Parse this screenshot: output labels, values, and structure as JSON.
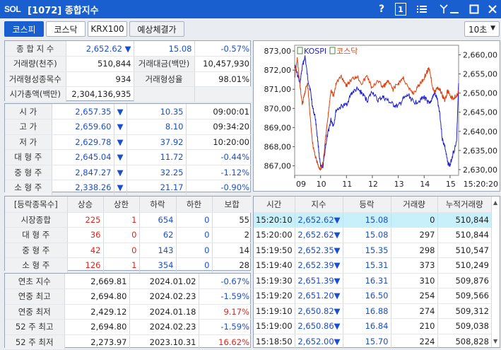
{
  "window": {
    "logo": "SOL",
    "title": "[1072] 종합지수"
  },
  "tabs": [
    "코스피",
    "코스닥",
    "KRX100",
    "예상체결가"
  ],
  "interval": "10초",
  "summary": {
    "index_label": "종 합 지 수",
    "index": "2,652.62",
    "change": "15.08",
    "change_pct": "-0.57%",
    "volume_label": "거래량(천주)",
    "volume": "510,844",
    "amount_label": "거래대금(백만)",
    "amount": "10,457,930",
    "formed_count_label": "거래형성종목수",
    "formed_count": "934",
    "formed_rate_label": "거래형성율",
    "formed_rate": "98.01%",
    "market_cap_label": "시가총액(백만)",
    "market_cap": "2,304,136,935"
  },
  "ohlc": [
    {
      "label": "시   가",
      "value": "2,657.35",
      "change": "10.35",
      "extra": "09:00:01",
      "extra_color": "black"
    },
    {
      "label": "고   가",
      "value": "2,659.60",
      "change": "8.10",
      "extra": "09:34:20",
      "extra_color": "black"
    },
    {
      "label": "저   가",
      "value": "2,629.78",
      "change": "37.92",
      "extra": "10:20:00",
      "extra_color": "black"
    },
    {
      "label": "대 형 주",
      "value": "2,645.04",
      "change": "11.72",
      "extra": "-0.44%",
      "extra_color": "blue"
    },
    {
      "label": "중 형 주",
      "value": "2,847.27",
      "change": "32.25",
      "extra": "-1.12%",
      "extra_color": "blue"
    },
    {
      "label": "소 형 주",
      "value": "2,338.26",
      "change": "21.17",
      "extra": "-0.90%",
      "extra_color": "blue"
    }
  ],
  "breadth": {
    "headers": [
      "[등락종목수]",
      "상승",
      "상한",
      "하락",
      "하한",
      "보합"
    ],
    "rows": [
      {
        "label": "시장종합",
        "up": "225",
        "upper": "1",
        "down": "654",
        "lower": "0",
        "flat": "55"
      },
      {
        "label": "대 형 주",
        "up": "36",
        "upper": "0",
        "down": "62",
        "lower": "0",
        "flat": "2"
      },
      {
        "label": "중 형 주",
        "up": "42",
        "upper": "0",
        "down": "143",
        "lower": "0",
        "flat": "14"
      },
      {
        "label": "소 형 주",
        "up": "126",
        "upper": "1",
        "down": "354",
        "lower": "0",
        "flat": "28"
      }
    ]
  },
  "yearly": [
    {
      "label": "연초  지수",
      "value": "2,669.81",
      "date": "2024.01.02",
      "pct": "-0.67%",
      "color": "blue"
    },
    {
      "label": "연중  최고",
      "value": "2,694.80",
      "date": "2024.02.23",
      "pct": "-1.59%",
      "color": "blue"
    },
    {
      "label": "연중  최저",
      "value": "2,429.12",
      "date": "2024.01.18",
      "pct": "9.17%",
      "color": "red"
    },
    {
      "label": "52 주 최고",
      "value": "2,694.80",
      "date": "2024.02.23",
      "pct": "-1.59%",
      "color": "blue"
    },
    {
      "label": "52 주 최저",
      "value": "2,273.97",
      "date": "2023.10.31",
      "pct": "16.62%",
      "color": "red"
    }
  ],
  "ticks": {
    "headers": [
      "시간",
      "지수",
      "등락",
      "거래량",
      "누적거래량"
    ],
    "rows": [
      {
        "time": "15:20:10",
        "index": "2,652.62",
        "change": "15.08",
        "vol": "0",
        "cum": "510,844"
      },
      {
        "time": "15:20:00",
        "index": "2,652.62",
        "change": "15.08",
        "vol": "297",
        "cum": "510,844"
      },
      {
        "time": "15:19:50",
        "index": "2,652.35",
        "change": "15.35",
        "vol": "298",
        "cum": "510,547"
      },
      {
        "time": "15:19:40",
        "index": "2,652.39",
        "change": "15.31",
        "vol": "373",
        "cum": "510,249"
      },
      {
        "time": "15:19:30",
        "index": "2,651.39",
        "change": "16.31",
        "vol": "310",
        "cum": "509,876"
      },
      {
        "time": "15:19:20",
        "index": "2,651.20",
        "change": "16.50",
        "vol": "254",
        "cum": "509,566"
      },
      {
        "time": "15:19:10",
        "index": "2,650.82",
        "change": "16.88",
        "vol": "274",
        "cum": "509,312"
      },
      {
        "time": "15:19:00",
        "index": "2,650.86",
        "change": "16.84",
        "vol": "210",
        "cum": "509,038"
      },
      {
        "time": "15:18:50",
        "index": "2,652.00",
        "change": "15.70",
        "vol": "224",
        "cum": "508,828"
      }
    ]
  },
  "chart_data": {
    "type": "line",
    "legend": [
      "KOSPI",
      "코스닥"
    ],
    "left_axis_ticks": [
      "873,00",
      "872,00",
      "871,00",
      "870,00",
      "869,00",
      "868,00",
      "867,00"
    ],
    "right_axis_ticks": [
      "2,660,00",
      "2,655,00",
      "2,650,00",
      "2,645,00",
      "2,640,00",
      "2,635,00",
      "2,630,00"
    ],
    "x_ticks": [
      "09",
      "10",
      "11",
      "12",
      "13",
      "14",
      "15",
      "15:20:20"
    ],
    "ylim_left": [
      866.5,
      873.3
    ],
    "ylim_right": [
      2628.5,
      2662.5
    ],
    "series": [
      {
        "name": "KOSPI",
        "axis": "right",
        "color": "#1f1fd0",
        "x": [
          9.0,
          9.1,
          9.2,
          9.3,
          9.4,
          9.5,
          9.6,
          9.7,
          9.8,
          9.9,
          10.0,
          10.1,
          10.2,
          10.3,
          10.4,
          10.5,
          10.6,
          10.8,
          11.0,
          11.2,
          11.4,
          11.6,
          11.8,
          12.0,
          12.2,
          12.4,
          12.6,
          12.8,
          13.0,
          13.2,
          13.4,
          13.6,
          13.8,
          14.0,
          14.1,
          14.2,
          14.3,
          14.4,
          14.5,
          14.6,
          14.7,
          14.8,
          14.9,
          15.0,
          15.1,
          15.25,
          15.33
        ],
        "y": [
          2657.3,
          2655.0,
          2652.5,
          2657.0,
          2659.6,
          2654.0,
          2651.0,
          2646.0,
          2643.5,
          2637.0,
          2630.5,
          2631.0,
          2636.5,
          2640.0,
          2643.0,
          2641.5,
          2645.5,
          2646.5,
          2647.0,
          2650.0,
          2651.0,
          2650.0,
          2648.0,
          2650.5,
          2648.0,
          2649.0,
          2648.0,
          2647.0,
          2646.5,
          2648.5,
          2649.5,
          2647.5,
          2648.0,
          2649.0,
          2648.0,
          2647.0,
          2648.5,
          2650.0,
          2648.5,
          2645.0,
          2638.0,
          2636.0,
          2632.0,
          2631.0,
          2634.0,
          2637.0,
          2652.6
        ]
      },
      {
        "name": "코스닥",
        "axis": "left",
        "color": "#e0400d",
        "x": [
          9.0,
          9.1,
          9.2,
          9.3,
          9.4,
          9.5,
          9.6,
          9.7,
          9.8,
          9.9,
          10.0,
          10.1,
          10.2,
          10.3,
          10.4,
          10.5,
          10.6,
          10.8,
          11.0,
          11.2,
          11.4,
          11.6,
          11.8,
          12.0,
          12.2,
          12.4,
          12.6,
          12.8,
          13.0,
          13.2,
          13.4,
          13.6,
          13.8,
          14.0,
          14.1,
          14.2,
          14.3,
          14.4,
          14.5,
          14.6,
          14.7,
          14.8,
          14.9,
          15.0,
          15.1,
          15.25,
          15.33
        ],
        "y": [
          871.6,
          872.6,
          871.2,
          870.2,
          870.9,
          871.3,
          869.5,
          868.1,
          867.5,
          867.0,
          866.8,
          867.2,
          868.5,
          869.7,
          871.0,
          870.6,
          871.3,
          871.7,
          871.2,
          871.5,
          871.7,
          871.3,
          871.7,
          871.0,
          871.5,
          871.1,
          871.4,
          871.0,
          871.3,
          871.6,
          871.0,
          870.8,
          871.2,
          871.6,
          871.9,
          872.1,
          871.3,
          870.8,
          871.1,
          871.0,
          870.7,
          870.4,
          870.9,
          870.7,
          870.5,
          870.7,
          870.9
        ]
      }
    ]
  }
}
